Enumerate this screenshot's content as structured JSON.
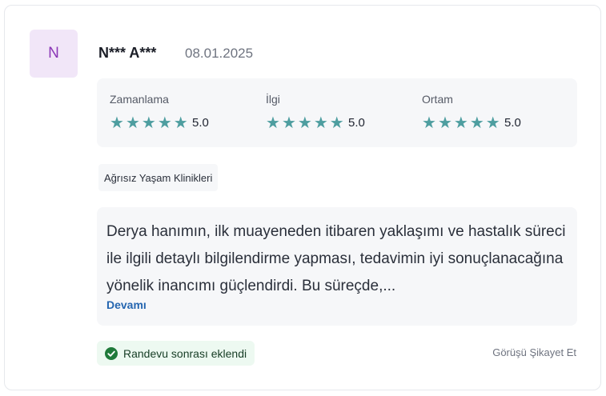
{
  "reviewer": {
    "initial": "N",
    "name": "N*** A***",
    "date": "08.01.2025"
  },
  "ratings": [
    {
      "label": "Zamanlama",
      "stars": 5,
      "score": "5.0"
    },
    {
      "label": "İlgi",
      "stars": 5,
      "score": "5.0"
    },
    {
      "label": "Ortam",
      "stars": 5,
      "score": "5.0"
    }
  ],
  "clinic": "Ağrısız Yaşam Klinikleri",
  "comment": {
    "text": "Derya hanımın, ilk muayeneden itibaren yaklaşımı ve hastalık süreci ile ilgili detaylı bilgilendirme yapması, tedavimin iyi sonuçlanacağına yönelik inancımı güçlendirdi. Bu süreçde,...",
    "more_label": "Devamı"
  },
  "badge": {
    "label": "Randevu sonrası eklendi",
    "icon": "check-circle-icon",
    "color": "#1f7a3a"
  },
  "report_label": "Görüşü Şikayet Et",
  "colors": {
    "star": "#4e9ea0",
    "avatar_bg": "#f1e6f8",
    "avatar_text": "#8a37b6",
    "link": "#2566b0"
  }
}
